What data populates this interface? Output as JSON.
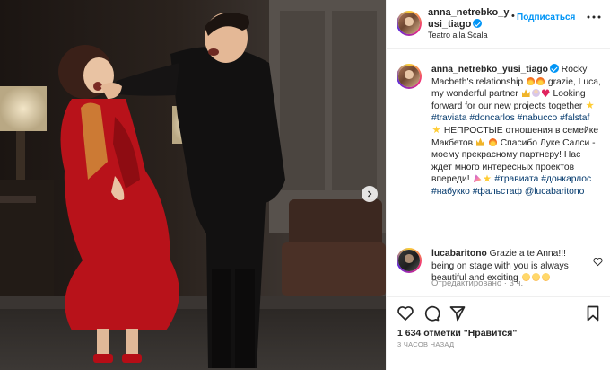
{
  "header": {
    "username": "anna_netrebko_yusi_tiago",
    "separator": "•",
    "follow_label": "Подписаться",
    "location": "Teatro alla Scala",
    "more_icon": "more-horizontal-icon"
  },
  "caption": {
    "username": "anna_netrebko_yusi_tiago",
    "part1": "Rocky Macbeth's relationship",
    "part2": "grazie, Luca, my wonderful partner",
    "part3": "Looking forward for our new projects together",
    "tag_traviata": "#traviata",
    "tag_doncarlos": "#doncarlos",
    "tag_nabucco": "#nabucco",
    "tag_falstaf": "#falstaf",
    "part4": "НЕПРОСТЫЕ отношения в семейке Макбетов",
    "part5": "Спасибо Луке Салси - моему прекрасному партнеру! Нас ждет много интересных проектов впереди!",
    "tag_traviata_ru": "#травиата",
    "tag_donkarlos_ru": "#донкарлос",
    "tag_nabukko_ru": "#набукко",
    "tag_falstaf_ru": "#фальстаф",
    "mention": "@lucabaritono",
    "meta": "Отредактировано · 3 ч."
  },
  "comment": {
    "username": "lucabaritono",
    "text": "Grazie a te Anna!!! being on stage with you is always beautiful and exciting"
  },
  "actions": {
    "likes": "1 634 отметки \"Нравится\"",
    "time": "3 ЧАСОВ НАЗАД"
  },
  "colors": {
    "accent": "#0095f6",
    "hashtag": "#00376b",
    "secondary_text": "#8e8e8e",
    "dress_red": "#c0141a"
  },
  "media": {
    "description_icon": "chevron-right-icon"
  }
}
